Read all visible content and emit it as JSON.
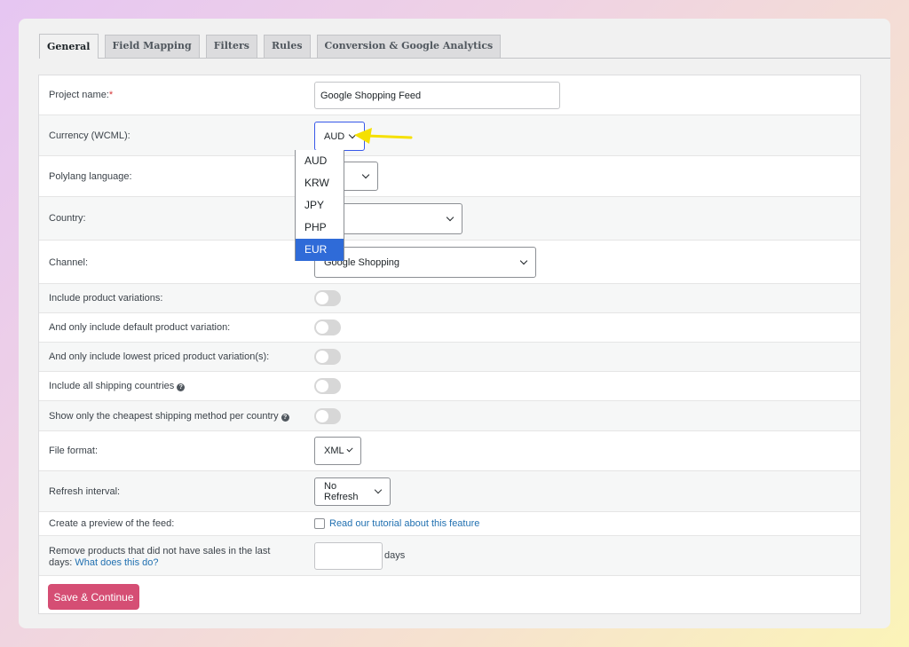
{
  "tabs": [
    "General",
    "Field Mapping",
    "Filters",
    "Rules",
    "Conversion & Google Analytics"
  ],
  "fields": {
    "project_name": {
      "label": "Project name:",
      "required": "*",
      "value": "Google Shopping Feed"
    },
    "currency": {
      "label": "Currency (WCML):",
      "value": "AUD"
    },
    "polylang": {
      "label": "Polylang language:"
    },
    "country": {
      "label": "Country:"
    },
    "channel": {
      "label": "Channel:",
      "value": "Google Shopping"
    },
    "variations": {
      "label": "Include product variations:"
    },
    "default_variation": {
      "label": "And only include default product variation:"
    },
    "lowest_variation": {
      "label": "And only include lowest priced product variation(s):"
    },
    "shipping_countries": {
      "label": "Include all shipping countries"
    },
    "cheapest_shipping": {
      "label": "Show only the cheapest shipping method per country"
    },
    "file_format": {
      "label": "File format:",
      "value": "XML"
    },
    "refresh": {
      "label": "Refresh interval:",
      "value": "No Refresh"
    },
    "preview": {
      "label": "Create a preview of the feed:",
      "link": "Read our tutorial about this feature"
    },
    "remove_products": {
      "label_line1": "Remove products that did not have sales in the last",
      "label_line2": "days:",
      "link": "What does this do?",
      "suffix": "days"
    }
  },
  "currency_options": [
    "AUD",
    "KRW",
    "JPY",
    "PHP",
    "EUR"
  ],
  "currency_highlighted": "EUR",
  "save_button": "Save & Continue",
  "colors": {
    "accent_button": "#d54e74",
    "highlight": "#2f6bd8",
    "arrow": "#f5e000"
  }
}
